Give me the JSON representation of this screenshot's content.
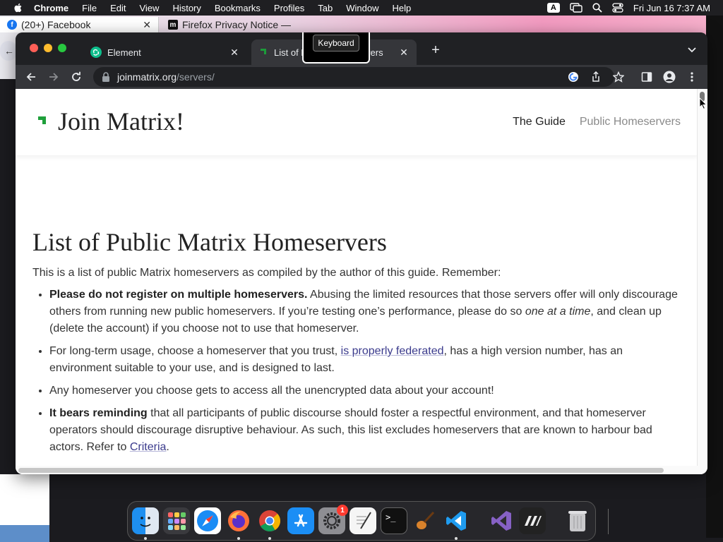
{
  "menubar": {
    "app_name": "Chrome",
    "items": [
      "File",
      "Edit",
      "View",
      "History",
      "Bookmarks",
      "Profiles",
      "Tab",
      "Window",
      "Help"
    ],
    "input_indicator": "A",
    "clock": "Fri Jun 16  7:37 AM"
  },
  "background_browser": {
    "tabs": [
      {
        "label": "(20+) Facebook"
      },
      {
        "label": "Firefox Privacy Notice —"
      }
    ]
  },
  "chrome": {
    "tabs": [
      {
        "label": "Element"
      },
      {
        "label": "List of Public Homeservers"
      }
    ],
    "tooltip": "Keyboard",
    "url_host": "joinmatrix.org",
    "url_path": "/servers/"
  },
  "site": {
    "title": "Join Matrix!",
    "nav": {
      "guide": "The Guide",
      "servers": "Public Homeservers"
    }
  },
  "page": {
    "heading": "List of Public Matrix Homeservers",
    "intro": "This is a list of public Matrix homeservers as compiled by the author of this guide. Remember:",
    "rule1_bold": "Please do not register on multiple homeservers.",
    "rule1_text": " Abusing the limited resources that those servers offer will only discourage others from running new public homeservers. If you’re testing one’s performance, please do so ",
    "rule1_em": "one at a time",
    "rule1_tail": ", and clean up (delete the account) if you choose not to use that homeserver.",
    "rule2_pre": "For long-term usage, choose a homeserver that you trust, ",
    "rule2_link": "is properly federated",
    "rule2_post": ", has a high version number, has an environment suitable to your use, and is designed to last.",
    "rule3": "Any homeserver you choose gets to access all the unencrypted data about your account!",
    "rule4_bold": "It bears reminding",
    "rule4_text": " that all participants of public discourse should foster a respectful environment, and that homeserver operators should discourage disruptive behaviour. As such, this list excludes homeservers that are known to harbour bad actors. Refer to ",
    "rule4_link": "Criteria",
    "rule4_tail": "."
  },
  "dock": {
    "settings_badge": "1"
  },
  "colors": {
    "matrix_green": "#0dbd8b",
    "link": "#3a3a8c",
    "chrome_dark": "#202124",
    "toolbar": "#35363a"
  }
}
